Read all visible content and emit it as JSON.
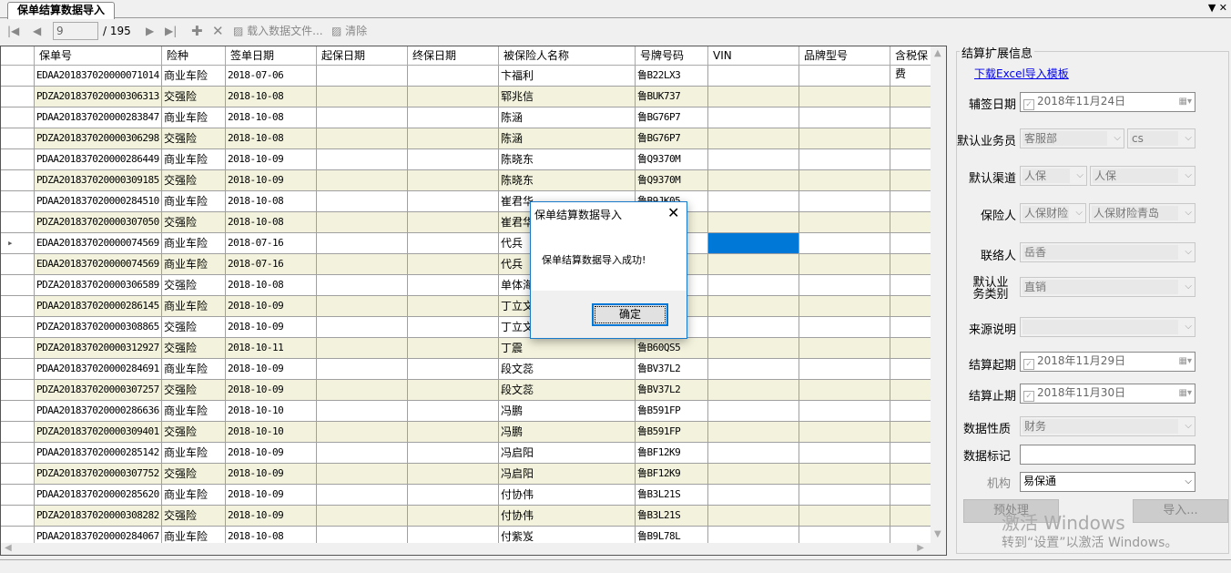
{
  "tab": {
    "title": "保单结算数据导入",
    "controls": "▼ ✕"
  },
  "toolbar": {
    "page": "9",
    "total": "/ 195",
    "load": "载入数据文件...",
    "clear": "清除"
  },
  "grid": {
    "columns": [
      "保单号",
      "险种",
      "签单日期",
      "起保日期",
      "终保日期",
      "被保险人名称",
      "号牌号码",
      "VIN",
      "品牌型号",
      "含税保费"
    ],
    "selected_row": 8,
    "selection_color": "#0078d7",
    "rows": [
      [
        "EDAA201837020000071014",
        "商业车险",
        "2018-07-06",
        "卞福利",
        "鲁B22LX3"
      ],
      [
        "PDZA201837020000306313",
        "交强险",
        "2018-10-08",
        "郓兆信",
        "鲁BUK737"
      ],
      [
        "PDAA201837020000283847",
        "商业车险",
        "2018-10-08",
        "陈涵",
        "鲁BG76P7"
      ],
      [
        "PDZA201837020000306298",
        "交强险",
        "2018-10-08",
        "陈涵",
        "鲁BG76P7"
      ],
      [
        "PDAA201837020000286449",
        "商业车险",
        "2018-10-09",
        "陈晓东",
        "鲁Q9370M"
      ],
      [
        "PDZA201837020000309185",
        "交强险",
        "2018-10-09",
        "陈晓东",
        "鲁Q9370M"
      ],
      [
        "PDAA201837020000284510",
        "商业车险",
        "2018-10-08",
        "崔君华",
        "鲁B9JK05"
      ],
      [
        "PDZA201837020000307050",
        "交强险",
        "2018-10-08",
        "崔君华",
        ""
      ],
      [
        "EDAA201837020000074569",
        "商业车险",
        "2018-07-16",
        "代兵",
        ""
      ],
      [
        "EDAA201837020000074569",
        "商业车险",
        "2018-07-16",
        "代兵",
        ""
      ],
      [
        "PDZA201837020000306589",
        "交强险",
        "2018-10-08",
        "单体海",
        ""
      ],
      [
        "PDAA201837020000286145",
        "商业车险",
        "2018-10-09",
        "丁立文",
        ""
      ],
      [
        "PDZA201837020000308865",
        "交强险",
        "2018-10-09",
        "丁立文",
        ""
      ],
      [
        "PDZA201837020000312927",
        "交强险",
        "2018-10-11",
        "丁震",
        "鲁B60QS5"
      ],
      [
        "PDAA201837020000284691",
        "商业车险",
        "2018-10-09",
        "段文蕊",
        "鲁BV37L2"
      ],
      [
        "PDZA201837020000307257",
        "交强险",
        "2018-10-09",
        "段文蕊",
        "鲁BV37L2"
      ],
      [
        "PDAA201837020000286636",
        "商业车险",
        "2018-10-10",
        "冯鹏",
        "鲁B591FP"
      ],
      [
        "PDZA201837020000309401",
        "交强险",
        "2018-10-10",
        "冯鹏",
        "鲁B591FP"
      ],
      [
        "PDAA201837020000285142",
        "商业车险",
        "2018-10-09",
        "冯启阳",
        "鲁BF12K9"
      ],
      [
        "PDZA201837020000307752",
        "交强险",
        "2018-10-09",
        "冯启阳",
        "鲁BF12K9"
      ],
      [
        "PDAA201837020000285620",
        "商业车险",
        "2018-10-09",
        "付协伟",
        "鲁B3L21S"
      ],
      [
        "PDZA201837020000308282",
        "交强险",
        "2018-10-09",
        "付协伟",
        "鲁B3L21S"
      ],
      [
        "PDAA201837020000284067",
        "商业车险",
        "2018-10-08",
        "付紫岌",
        "鲁B9L78L"
      ]
    ]
  },
  "panel": {
    "title": "结算扩展信息",
    "download_link": "下载Excel导入模板",
    "fields": {
      "sign_date": {
        "label": "辅签日期",
        "value": "2018年11月24日"
      },
      "salesman": {
        "label": "默认业务员",
        "value1": "客服部",
        "value2": "cs"
      },
      "channel": {
        "label": "默认渠道",
        "value1": "人保",
        "value2": "人保"
      },
      "insurer": {
        "label": "保险人",
        "value1": "人保财险",
        "value2": "人保财险青岛"
      },
      "contact": {
        "label": "联络人",
        "value": "岳香"
      },
      "biz_type": {
        "label": "默认业务类别",
        "value": "直销"
      },
      "source": {
        "label": "来源说明",
        "value": ""
      },
      "start": {
        "label": "结算起期",
        "value": "2018年11月29日"
      },
      "end": {
        "label": "结算止期",
        "value": "2018年11月30日"
      },
      "nature": {
        "label": "数据性质",
        "value": "财务"
      },
      "mark": {
        "label": "数据标记",
        "value": ""
      },
      "org": {
        "label": "机构",
        "value": "易保通"
      }
    },
    "preprocess": "预处理",
    "import": "导入..."
  },
  "watermark": {
    "line1": "激活 Windows",
    "line2": "转到“设置”以激活 Windows。"
  },
  "dialog": {
    "title": "保单结算数据导入",
    "message": "保单结算数据导入成功!",
    "ok": "确定"
  }
}
